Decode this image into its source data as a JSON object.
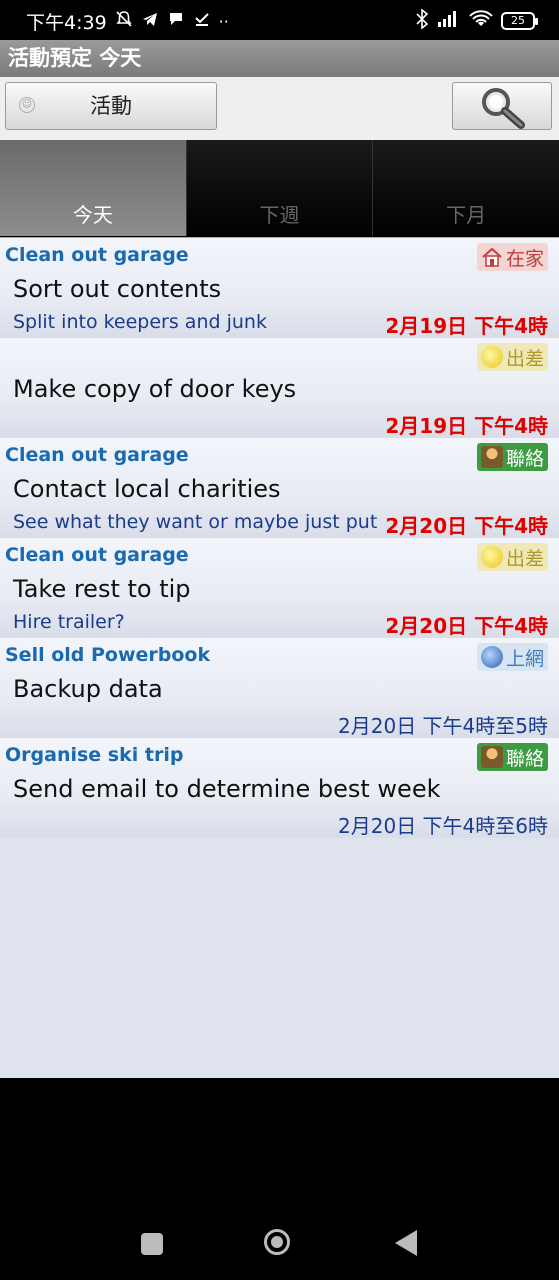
{
  "status_bar": {
    "time": "下午4:39",
    "battery": "25"
  },
  "title": "活動預定 今天",
  "toolbar": {
    "activity_label": "活動"
  },
  "tabs": [
    {
      "label": "今天",
      "active": true
    },
    {
      "label": "下週",
      "active": false
    },
    {
      "label": "下月",
      "active": false
    }
  ],
  "items": [
    {
      "project": "Clean out garage",
      "task": "Sort out contents",
      "note": "Split into keepers and junk",
      "date": "2月19日 下午4時",
      "context": "在家",
      "context_icon": "home-icon",
      "due": true
    },
    {
      "project": "",
      "task": "Make copy of door keys",
      "note": "",
      "date": "2月19日 下午4時",
      "context": "出差",
      "context_icon": "errand-icon",
      "due": true
    },
    {
      "project": "Clean out garage",
      "task": "Contact local charities",
      "note": "See what they want or maybe just put in c..",
      "date": "2月20日 下午4時",
      "context": "聯絡",
      "context_icon": "contact-icon",
      "due": true
    },
    {
      "project": "Clean out garage",
      "task": "Take rest to tip",
      "note": "Hire trailer?",
      "date": "2月20日 下午4時",
      "context": "出差",
      "context_icon": "errand-icon",
      "due": true
    },
    {
      "project": "Sell old Powerbook",
      "task": "Backup data",
      "note": "",
      "date": "2月20日 下午4時至5時",
      "context": "上網",
      "context_icon": "globe-icon",
      "due": false
    },
    {
      "project": "Organise ski trip",
      "task": "Send email to determine best week",
      "note": "",
      "date": "2月20日 下午4時至6時",
      "context": "聯絡",
      "context_icon": "contact-icon",
      "due": false
    }
  ]
}
